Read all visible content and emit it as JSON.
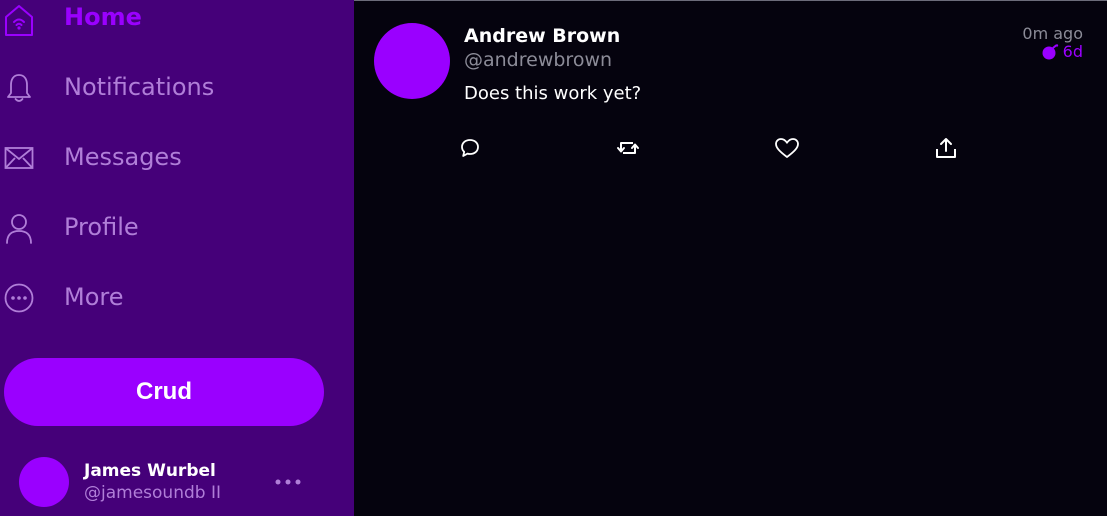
{
  "sidebar": {
    "items": [
      {
        "label": "Home",
        "icon": "home-icon",
        "active": true
      },
      {
        "label": "Notifications",
        "icon": "bell-icon"
      },
      {
        "label": "Messages",
        "icon": "envelope-icon"
      },
      {
        "label": "Profile",
        "icon": "user-icon"
      },
      {
        "label": "More",
        "icon": "more-circle-icon"
      }
    ],
    "compose_label": "Crud",
    "account": {
      "name": "James Wurbel",
      "handle": "@jamesoundb II"
    }
  },
  "feed": {
    "tweet": {
      "author": "Andrew Brown",
      "handle": "@andrewbrown",
      "time": "0m ago",
      "expiry": "6d",
      "body": "Does this work yet?",
      "actions": [
        "reply-icon",
        "retweet-icon",
        "like-icon",
        "share-icon"
      ]
    }
  },
  "colors": {
    "sidebar_bg": "#450079",
    "accent": "#9a00ff",
    "muted_sidebar_text": "#b07ed8",
    "main_bg": "#05030e",
    "muted_text": "#8c8c98"
  }
}
